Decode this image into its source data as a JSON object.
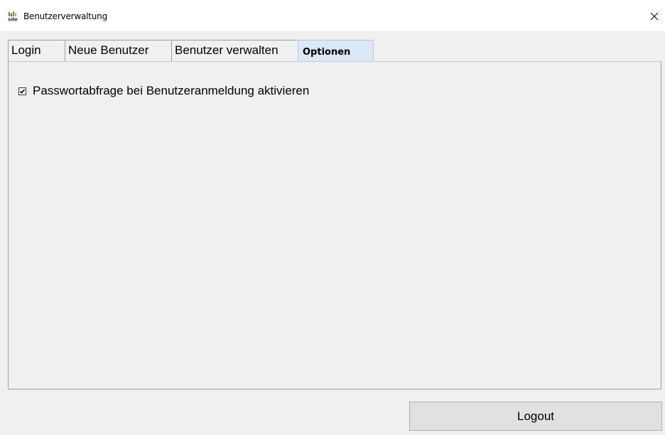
{
  "window": {
    "title": "Benutzerverwaltung",
    "app_icon": "sde-app-icon",
    "close_icon": "close-icon"
  },
  "tabs": [
    {
      "label": "Login",
      "active": false
    },
    {
      "label": "Neue Benutzer",
      "active": false
    },
    {
      "label": "Benutzer verwalten",
      "active": false
    },
    {
      "label": "Optionen",
      "active": true
    }
  ],
  "options": {
    "password_prompt": {
      "label": "Passwortabfrage bei Benutzeranmeldung aktivieren",
      "checked": true
    }
  },
  "footer": {
    "logout_label": "Logout"
  },
  "colors": {
    "active_tab": "#dbe8f5",
    "background": "#f0f0f0",
    "titlebar": "#ffffff"
  }
}
